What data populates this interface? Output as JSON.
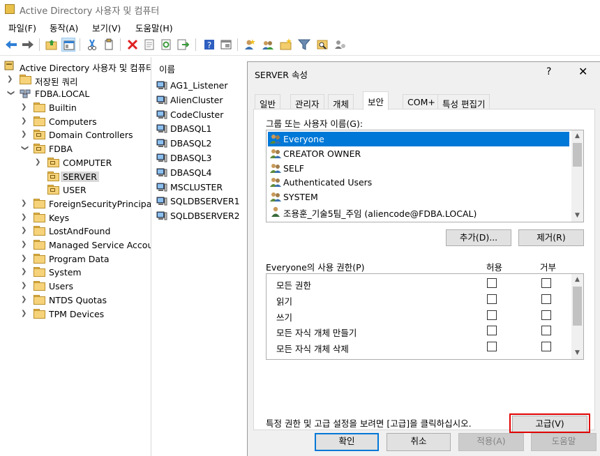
{
  "window": {
    "title": "Active Directory 사용자 및 컴퓨터"
  },
  "menu": [
    "파일(F)",
    "동작(A)",
    "보기(V)",
    "도움말(H)"
  ],
  "toolbar": {
    "icons": [
      "back-icon",
      "forward-icon",
      "up-folder-icon",
      "console-tree-icon",
      "cut-icon",
      "copy-icon",
      "delete-icon",
      "properties-icon",
      "refresh-icon",
      "export-icon",
      "help-icon",
      "console-icon",
      "new-user-icon",
      "new-group-icon",
      "new-ou-icon",
      "filter-icon",
      "find-icon",
      "delegate-icon"
    ]
  },
  "tree": {
    "root": "Active Directory 사용자 및 컴퓨터",
    "saved_queries": "저장된 쿼리",
    "domain": "FDBA.LOCAL",
    "items": [
      {
        "label": "Builtin",
        "level": 2,
        "expand": "closed",
        "kind": "folder"
      },
      {
        "label": "Computers",
        "level": 2,
        "expand": "closed",
        "kind": "folder"
      },
      {
        "label": "Domain Controllers",
        "level": 2,
        "expand": "closed",
        "kind": "ou"
      },
      {
        "label": "FDBA",
        "level": 2,
        "expand": "open",
        "kind": "ou"
      },
      {
        "label": "COMPUTER",
        "level": 3,
        "expand": "closed",
        "kind": "ou"
      },
      {
        "label": "SERVER",
        "level": 3,
        "expand": "none",
        "kind": "ou",
        "selected": true
      },
      {
        "label": "USER",
        "level": 3,
        "expand": "none",
        "kind": "ou"
      },
      {
        "label": "ForeignSecurityPrincipals",
        "level": 2,
        "expand": "closed",
        "kind": "folder"
      },
      {
        "label": "Keys",
        "level": 2,
        "expand": "closed",
        "kind": "folder"
      },
      {
        "label": "LostAndFound",
        "level": 2,
        "expand": "closed",
        "kind": "folder"
      },
      {
        "label": "Managed Service Accounts",
        "level": 2,
        "expand": "closed",
        "kind": "folder"
      },
      {
        "label": "Program Data",
        "level": 2,
        "expand": "closed",
        "kind": "folder"
      },
      {
        "label": "System",
        "level": 2,
        "expand": "closed",
        "kind": "folder"
      },
      {
        "label": "Users",
        "level": 2,
        "expand": "closed",
        "kind": "folder"
      },
      {
        "label": "NTDS Quotas",
        "level": 2,
        "expand": "closed",
        "kind": "folder"
      },
      {
        "label": "TPM Devices",
        "level": 2,
        "expand": "closed",
        "kind": "folder"
      }
    ]
  },
  "list": {
    "header": "이름",
    "items": [
      "AG1_Listener",
      "AlienCluster",
      "CodeCluster",
      "DBASQL1",
      "DBASQL2",
      "DBASQL3",
      "DBASQL4",
      "MSCLUSTER",
      "SQLDBSERVER1",
      "SQLDBSERVER2"
    ]
  },
  "dialog": {
    "title": "SERVER 속성",
    "help": "?",
    "close": "✕",
    "tabs": [
      "일반",
      "관리자",
      "개체",
      "보안",
      "COM+",
      "특성 편집기"
    ],
    "active_tab": "보안",
    "groups_label": "그룹 또는 사용자 이름(G):",
    "principals": [
      {
        "name": "Everyone",
        "type": "group",
        "selected": true
      },
      {
        "name": "CREATOR OWNER",
        "type": "group"
      },
      {
        "name": "SELF",
        "type": "group"
      },
      {
        "name": "Authenticated Users",
        "type": "group"
      },
      {
        "name": "SYSTEM",
        "type": "group"
      },
      {
        "name": "조용훈_기술5팀_주임 (aliencode@FDBA.LOCAL)",
        "type": "user"
      }
    ],
    "add_button": "추가(D)...",
    "remove_button": "제거(R)",
    "permissions_label": "Everyone의 사용 권한(P)",
    "allow_header": "허용",
    "deny_header": "거부",
    "permissions": [
      {
        "name": "모든 권한",
        "allow": false,
        "deny": false
      },
      {
        "name": "읽기",
        "allow": false,
        "deny": false
      },
      {
        "name": "쓰기",
        "allow": false,
        "deny": false
      },
      {
        "name": "모든 자식 개체 만들기",
        "allow": false,
        "deny": false
      },
      {
        "name": "모든 자식 개체 삭제",
        "allow": false,
        "deny": false
      }
    ],
    "advanced_hint": "특정 권한 및 고급 설정을 보려면 [고급]을 클릭하십시오.",
    "advanced_button": "고급(V)",
    "ok_button": "확인",
    "cancel_button": "취소",
    "apply_button": "적용(A)",
    "help_button": "도움말"
  },
  "colors": {
    "selection": "#0078d7",
    "highlight_box": "#e00000"
  }
}
